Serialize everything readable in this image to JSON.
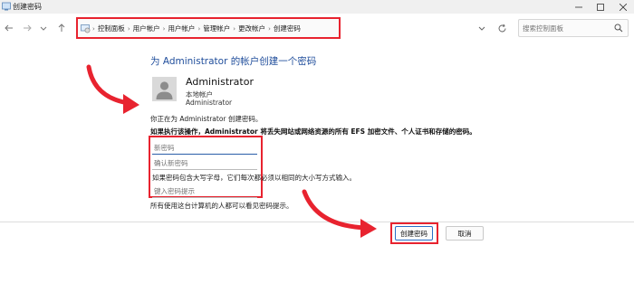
{
  "window": {
    "title": "创建密码"
  },
  "nav": {
    "breadcrumbs": [
      "控制面板",
      "用户帐户",
      "用户帐户",
      "管理帐户",
      "更改帐户",
      "创建密码"
    ],
    "search_placeholder": "搜索控制面板"
  },
  "main": {
    "heading": "为 Administrator 的帐户创建一个密码",
    "account_name": "Administrator",
    "account_type": "本地帐户",
    "account_name_sub": "Administrator",
    "info_text": "你正在为 Administrator 创建密码。",
    "warning_text": "如果执行该操作，Administrator 将丢失网站或网络资源的所有 EFS 加密文件、个人证书和存储的密码。",
    "new_password_placeholder": "新密码",
    "confirm_password_placeholder": "确认新密码",
    "case_info": "如果密码包含大写字母，它们每次都必须以相同的大小写方式输入。",
    "hint_placeholder": "键入密码提示",
    "hint_info": "所有使用这台计算机的人都可以看见密码提示。"
  },
  "buttons": {
    "create": "创建密码",
    "cancel": "取消"
  },
  "colors": {
    "annotation_red": "#e8232f",
    "heading_blue": "#1f4d9b"
  }
}
